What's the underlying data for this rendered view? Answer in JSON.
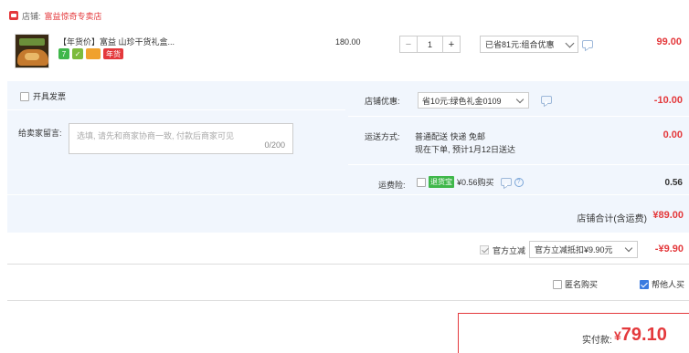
{
  "store": {
    "label": "店铺:",
    "name": "富益惊奇专卖店"
  },
  "item": {
    "title": "【年货价】富益 山珍干货礼盒...",
    "tags": [
      "7",
      "",
      "",
      "年货"
    ],
    "unit_price": "180.00",
    "quantity": "1",
    "minus": "−",
    "plus": "+",
    "promo_selected": "已省81元:组合优惠",
    "total": "99.00"
  },
  "invoice": {
    "label": "开具发票"
  },
  "note": {
    "label": "给卖家留言:",
    "placeholder": "选填, 请先和商家协商一致, 付款后商家可见",
    "count": "0/200"
  },
  "shop_discount": {
    "label": "店铺优惠:",
    "selected": "省10元:绿色礼金0109",
    "amount": "-10.00"
  },
  "shipping": {
    "label": "运送方式:",
    "method": "普通配送 快递 免邮",
    "eta": "现在下单, 预计1月12日送达",
    "amount": "0.00"
  },
  "insurance": {
    "label": "运费险:",
    "badge": "退货宝",
    "text": "¥0.56购买",
    "help": "?",
    "amount": "0.56"
  },
  "shop_total": {
    "label": "店铺合计(含运费)",
    "amount": "¥89.00"
  },
  "instant_discount": {
    "label": "官方立减",
    "selected": "官方立减抵扣¥9.90元",
    "amount": "-¥9.90"
  },
  "options": {
    "anonymous": "匿名购买",
    "buy_for_others": "帮他人买"
  },
  "payment": {
    "label": "实付款:",
    "currency": "¥",
    "amount": "79.10"
  },
  "colors": {
    "accent": "#e4393c",
    "panel": "#f1f6fd"
  }
}
